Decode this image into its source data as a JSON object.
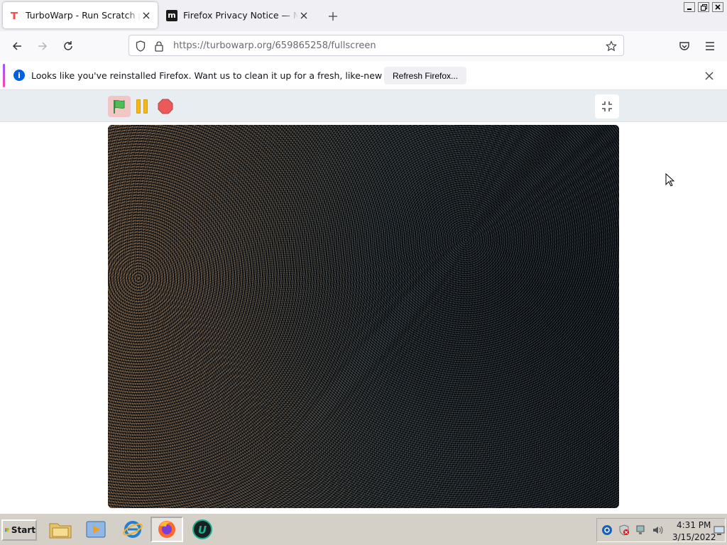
{
  "tabs": [
    {
      "title": "TurboWarp - Run Scratch projects",
      "active": true,
      "favicon": "turbowarp-icon"
    },
    {
      "title": "Firefox Privacy Notice — Mozilla",
      "active": false,
      "favicon": "mozilla-icon"
    }
  ],
  "new_tab_label": "+",
  "urlbar": {
    "host": "https://turbowarp.org",
    "path": "/659865258/fullscreen"
  },
  "notification": {
    "message": "Looks like you've reinstalled Firefox. Want us to clean it up for a fresh, like-new experience?",
    "button": "Refresh Firefox...",
    "info_glyph": "i"
  },
  "taskbar": {
    "start_label": "Start",
    "time": "4:31 PM",
    "date": "3/15/2022"
  },
  "colors": {
    "flag_green": "#4cbf56",
    "pause_yellow": "#f5b81b",
    "stop_red": "#ec5959",
    "accent_blue": "#0060df"
  }
}
